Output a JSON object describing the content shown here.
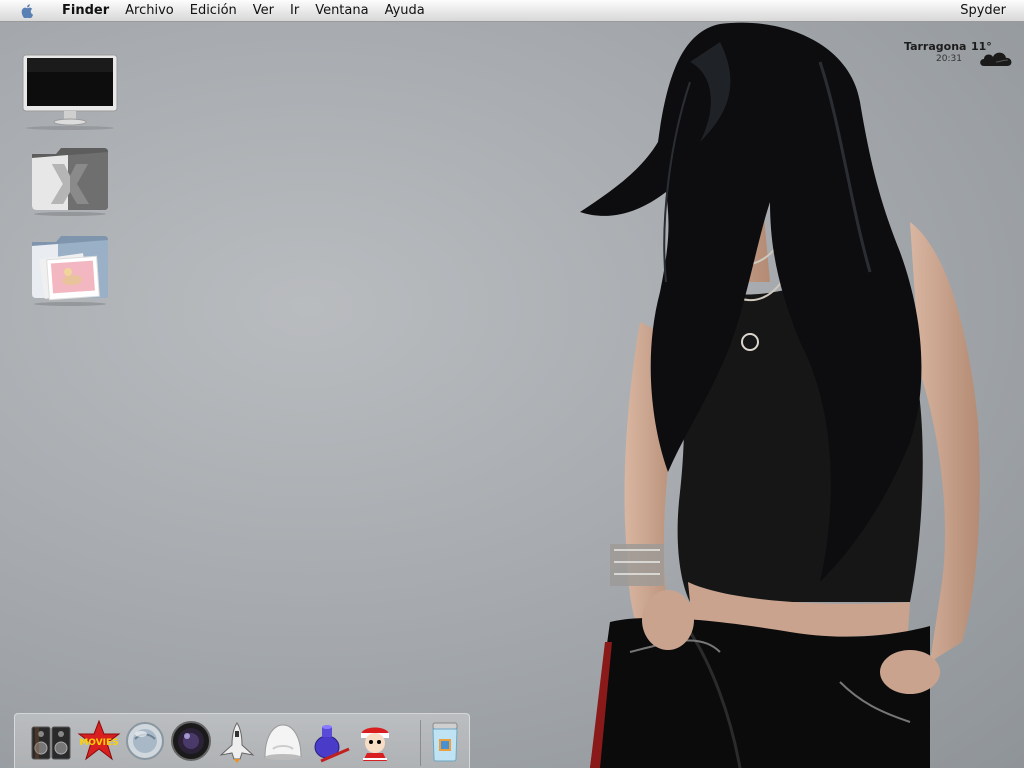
{
  "menubar": {
    "apple_icon": "apple-icon",
    "items": [
      {
        "label": "Finder",
        "bold": true
      },
      {
        "label": "Archivo"
      },
      {
        "label": "Edición"
      },
      {
        "label": "Ver"
      },
      {
        "label": "Ir"
      },
      {
        "label": "Ventana"
      },
      {
        "label": "Ayuda"
      }
    ],
    "right_label": "Spyder"
  },
  "weather": {
    "city": "Tarragona",
    "temperature": "11°",
    "time": "20:31",
    "icon": "cloud-icon"
  },
  "desktop_icons": [
    {
      "name": "monitor-icon"
    },
    {
      "name": "osx-folder-icon"
    },
    {
      "name": "pictures-folder-icon"
    }
  ],
  "dock": {
    "items": [
      {
        "name": "speakers-icon"
      },
      {
        "name": "movies-icon",
        "text": "MOVIES"
      },
      {
        "name": "globe-icon"
      },
      {
        "name": "camera-lens-icon"
      },
      {
        "name": "space-shuttle-icon"
      },
      {
        "name": "dome-icon"
      },
      {
        "name": "ink-bottle-icon"
      },
      {
        "name": "cartoon-character-icon"
      },
      {
        "name": "trash-jar-icon"
      }
    ]
  },
  "colors": {
    "desktop_background": "#a7abaf",
    "menubar": "#e6e6e6"
  }
}
